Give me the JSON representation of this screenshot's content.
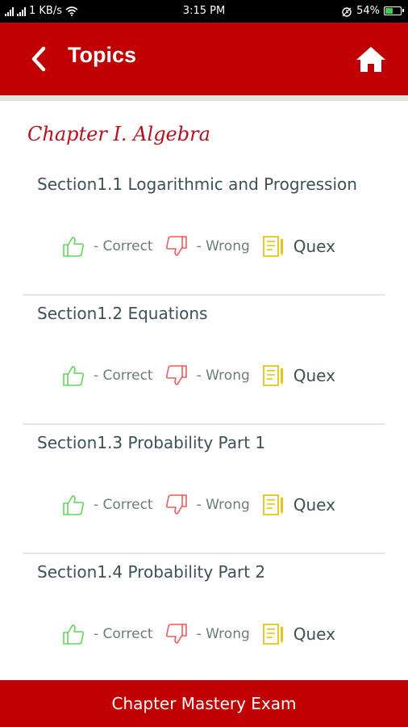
{
  "status_bar": {
    "network_speed": "1 KB/s",
    "time": "3:15 PM",
    "battery": "54%",
    "battery_level": 0.54,
    "icons": [
      "signal-icon",
      "wifi-icon",
      "alarm-icon",
      "battery-icon"
    ]
  },
  "header": {
    "title": "Topics",
    "back_icon": "chevron-left-icon",
    "home_icon": "home-icon",
    "color": "#c00000"
  },
  "chapter": {
    "title": "Chapter I. Algebra",
    "color": "#b3121f"
  },
  "labels": {
    "correct": "- Correct",
    "wrong": "- Wrong",
    "quex": "Quex"
  },
  "colors": {
    "correct": "#5ed65a",
    "wrong": "#ef5b5b",
    "quex": "#e7c21a"
  },
  "sections": [
    {
      "title": "Section1.1 Logarithmic and Progression"
    },
    {
      "title": "Section1.2 Equations"
    },
    {
      "title": "Section1.3 Probability Part 1"
    },
    {
      "title": "Section1.4 Probability Part 2"
    }
  ],
  "footer": {
    "label": "Chapter Mastery Exam"
  }
}
